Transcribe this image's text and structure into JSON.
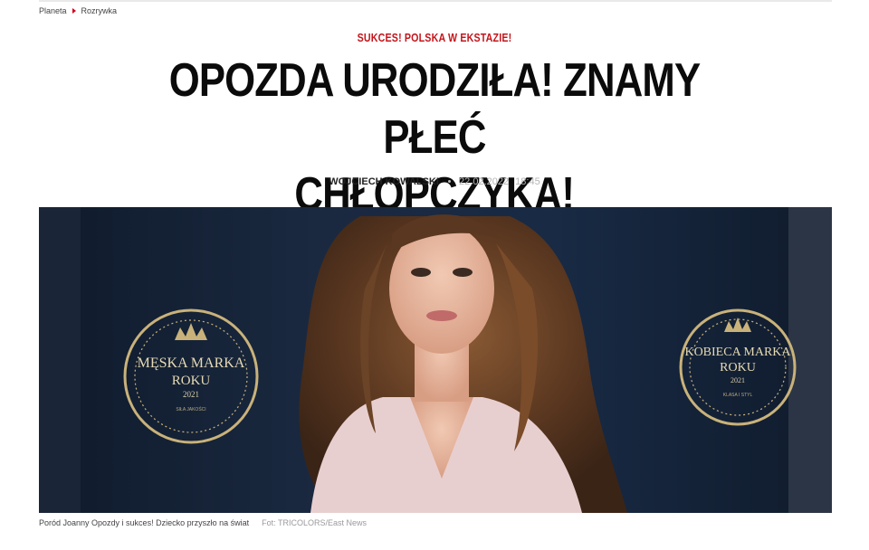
{
  "breadcrumb": {
    "items": [
      "Planeta",
      "Rozrywka"
    ]
  },
  "article": {
    "kicker": "SUKCES! POLSKA W EKSTAZIE!",
    "headline_line1": "OPOZDA URODZIŁA! ZNAMY PŁEĆ",
    "headline_line2": "CHŁOPCZYKA!",
    "author": "WOJCIECH KOWALSKI",
    "date": "22.02.2022",
    "time": "18:45"
  },
  "photo": {
    "left_logo": {
      "line1": "MĘSKA MARKA",
      "line2": "ROKU",
      "year": "2021",
      "tagline": "SIŁA JAKOŚCI"
    },
    "right_logo": {
      "line1": "KOBIECA MARKA",
      "line2": "ROKU",
      "year": "2021",
      "tagline": "KLASA I STYL"
    }
  },
  "caption": {
    "text": "Poród Joanny Opozdy i sukces! Dziecko przyszło na świat",
    "credit": "Fot: TRICOLORS/East News"
  },
  "colors": {
    "accent_red": "#c4161c",
    "photo_background": "#142235",
    "gold": "#c9b27a"
  }
}
